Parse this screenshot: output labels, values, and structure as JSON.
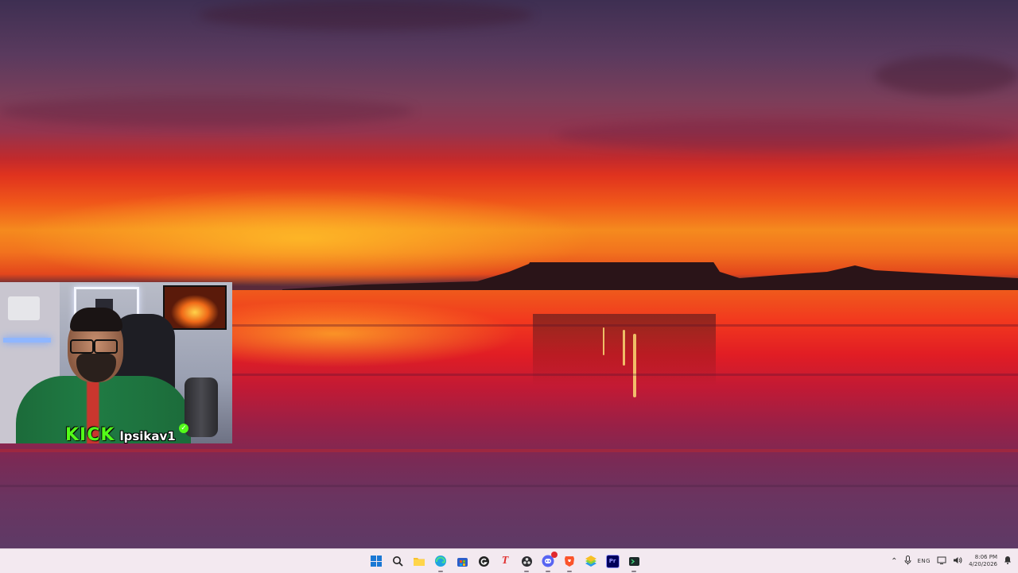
{
  "wallpaper": {
    "description_colors": {
      "sky_top": "#3e2f52",
      "sun_band": "#f58a1e",
      "water_red": "#e11d24"
    }
  },
  "webcam": {
    "brand_text": "KICK",
    "handle_text": "lpsikav1",
    "brand_color": "#53fc18"
  },
  "taskbar": {
    "apps": [
      {
        "name": "start-button",
        "icon": "windows-icon"
      },
      {
        "name": "search-button",
        "icon": "search-icon"
      },
      {
        "name": "file-explorer-button",
        "icon": "folder-icon"
      },
      {
        "name": "edge-button",
        "icon": "edge-icon"
      },
      {
        "name": "store-button",
        "icon": "store-icon"
      },
      {
        "name": "chrome-like-button",
        "icon": "g-circle-icon"
      },
      {
        "name": "typora-button",
        "icon": "t-icon"
      },
      {
        "name": "obs-button",
        "icon": "obs-icon"
      },
      {
        "name": "discord-button",
        "icon": "discord-icon",
        "badge": ""
      },
      {
        "name": "brave-button",
        "icon": "brave-lion-icon"
      },
      {
        "name": "bluestacks-button",
        "icon": "bluestacks-icon"
      },
      {
        "name": "premiere-button",
        "icon": "premiere-icon",
        "label": "Pr"
      },
      {
        "name": "terminal-button",
        "icon": "terminal-icon"
      }
    ],
    "tray": {
      "lang": "ENG",
      "time": "8:06 PM",
      "date": "4/20/2026"
    }
  }
}
